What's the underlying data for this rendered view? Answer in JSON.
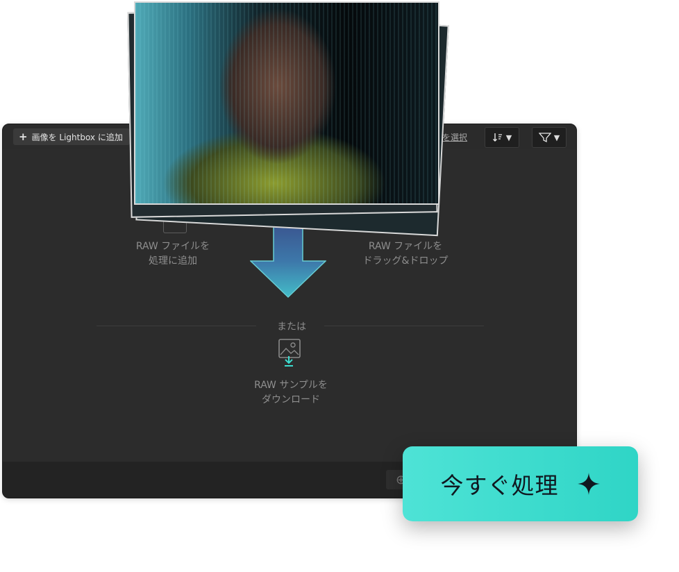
{
  "toolbar": {
    "add_label": "画像を Lightbox に追加",
    "select_label": "を選択"
  },
  "options": {
    "add_raw": "RAW ファイルを\n処理に追加",
    "drag_drop": "RAW ファイルを\nドラッグ&ドロップ",
    "or": "または",
    "download_sample": "RAW サンプルを\nダウンロード"
  },
  "cta": {
    "label": "今すぐ処理"
  },
  "colors": {
    "accent": "#3ddccf",
    "window_bg": "#2c2c2c"
  }
}
